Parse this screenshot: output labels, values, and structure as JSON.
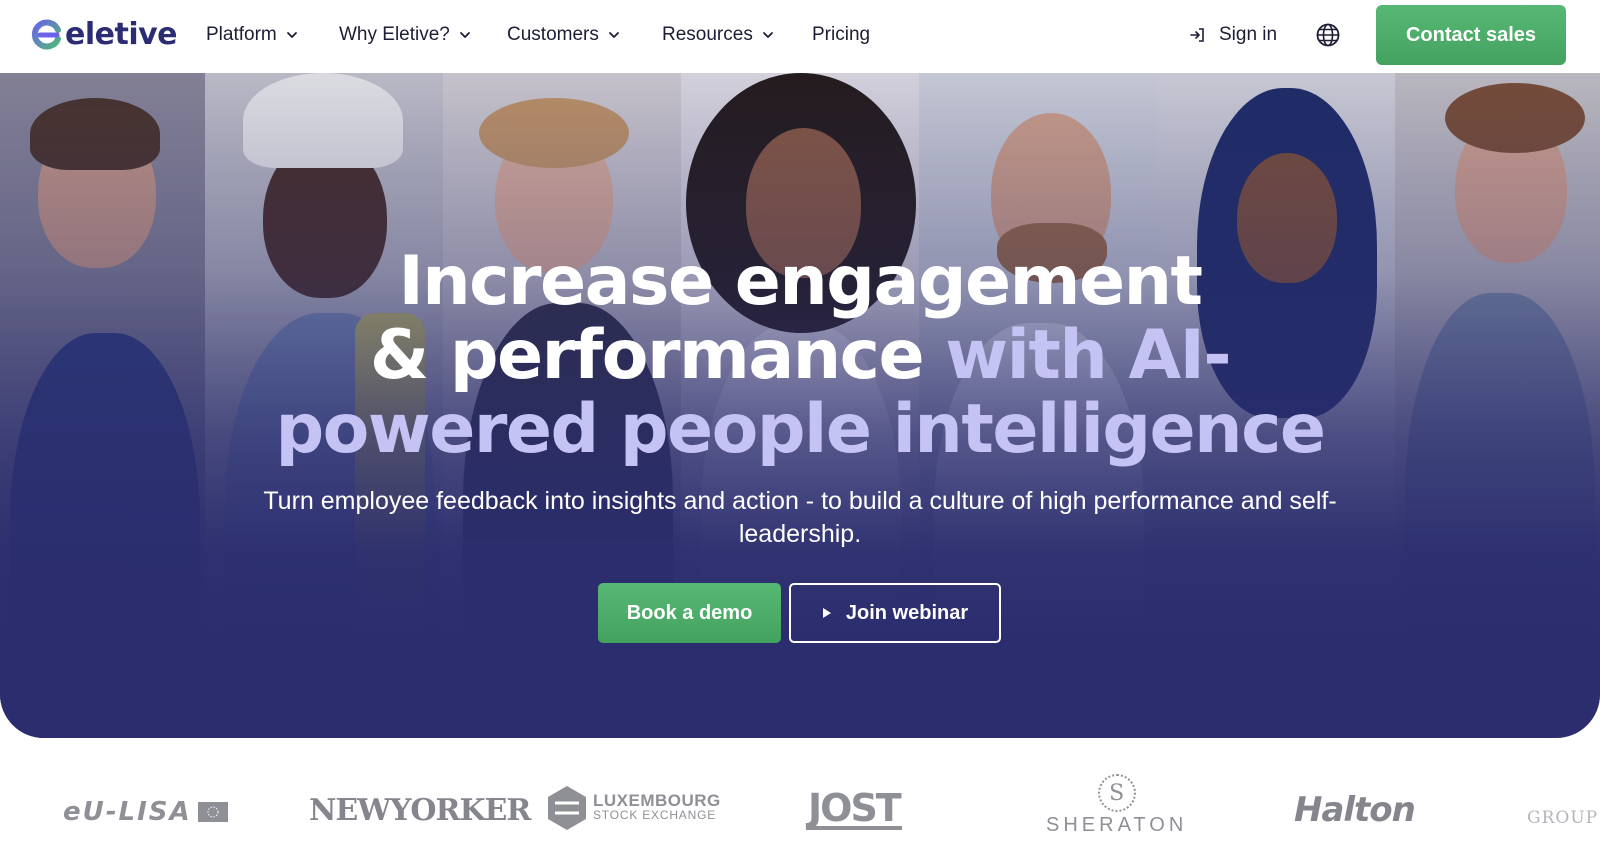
{
  "brand": {
    "name": "eletive",
    "primary": "#2b2d6e",
    "accent_green": "#4caf6a",
    "accent_lavender": "#c5c2f4"
  },
  "nav": {
    "items": [
      {
        "label": "Platform",
        "has_dropdown": true
      },
      {
        "label": "Why Eletive?",
        "has_dropdown": true
      },
      {
        "label": "Customers",
        "has_dropdown": true
      },
      {
        "label": "Resources",
        "has_dropdown": true
      },
      {
        "label": "Pricing",
        "has_dropdown": false
      }
    ],
    "sign_in": "Sign in",
    "sign_in_icon": "sign-in-arrow-icon",
    "language_icon": "globe-icon",
    "contact_sales": "Contact sales"
  },
  "hero": {
    "headline_line1": "Increase engagement",
    "headline_line2_white": "& performance",
    "headline_line2_accent": "with AI-",
    "headline_line3_accent": "powered people intelligence",
    "subheadline": "Turn employee feedback into insights and action - to build a culture of high performance and self-leadership.",
    "cta_primary": "Book a demo",
    "cta_secondary": "Join webinar",
    "cta_secondary_icon": "play-triangle-icon"
  },
  "customers": {
    "logos": [
      {
        "name": "eu-LISA",
        "text": "eU-LISA"
      },
      {
        "name": "New Yorker",
        "text": "NEWYORKER"
      },
      {
        "name": "Luxembourg Stock Exchange",
        "text_top": "LUXEMBOURG",
        "text_bottom": "STOCK EXCHANGE"
      },
      {
        "name": "Jost",
        "text": "JOST"
      },
      {
        "name": "Sheraton",
        "text": "SHERATON",
        "monogram": "S"
      },
      {
        "name": "Halton",
        "text": "Halton"
      },
      {
        "name": "Group (partial)",
        "text": "GROUP"
      }
    ]
  }
}
